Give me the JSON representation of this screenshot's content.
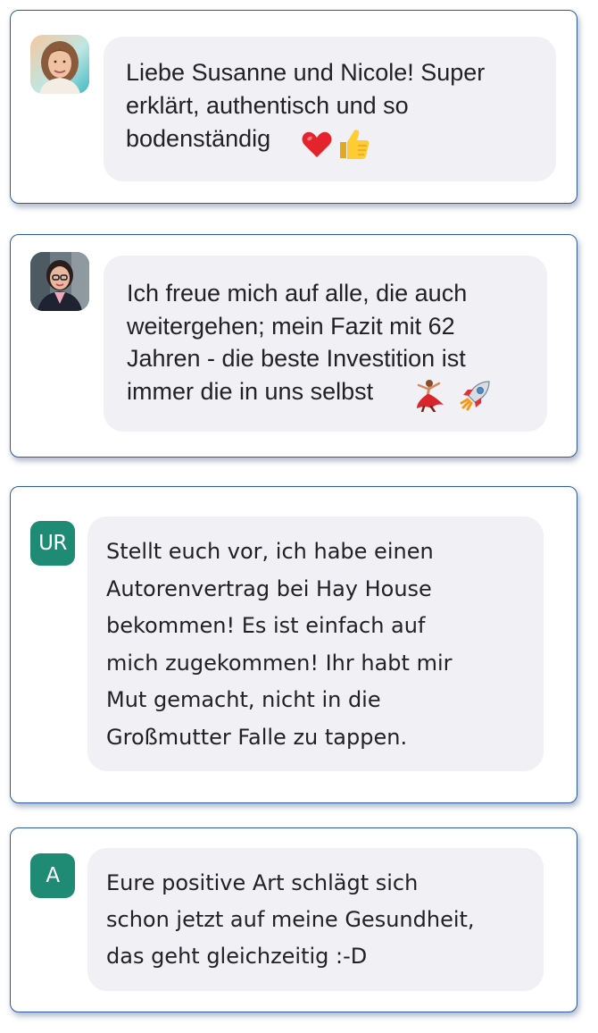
{
  "messages": [
    {
      "avatar": {
        "type": "photo",
        "icon": "woman-portrait-light-hair"
      },
      "text": "Liebe Susanne und Nicole! Super\nerklärt, authentisch und so\nbodenständig",
      "emojis": [
        "red-heart-icon",
        "thumbs-up-icon"
      ]
    },
    {
      "avatar": {
        "type": "photo",
        "icon": "woman-portrait-dark-hair-glasses"
      },
      "text": "Ich freue mich auf alle, die auch\nweitergehen; mein Fazit mit 62\nJahren - die beste Investition ist\nimmer die in uns selbst",
      "emojis": [
        "dancer-icon",
        "rocket-icon"
      ]
    },
    {
      "avatar": {
        "type": "initials",
        "initials": "UR",
        "color": "#1f8b74"
      },
      "text": "Stellt euch vor, ich habe einen\nAutorenvertrag bei Hay House\nbekommen! Es ist einfach auf\nmich zugekommen! Ihr habt mir\nMut gemacht,  nicht in die\nGroßmutter Falle zu tappen.",
      "emojis": []
    },
    {
      "avatar": {
        "type": "initials",
        "initials": "A",
        "color": "#1f8b74"
      },
      "text": "Eure positive Art schlägt sich\nschon jetzt auf meine Gesundheit,\ndas geht gleichzeitig :-D",
      "emojis": []
    }
  ],
  "colors": {
    "card_border": "#2f5b9b",
    "bubble_background": "#f0f0f5",
    "text": "#222222",
    "initials_avatar": "#1f8b74"
  }
}
